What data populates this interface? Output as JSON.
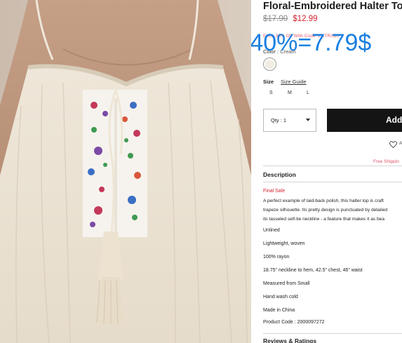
{
  "product": {
    "title": "Floral-Embroidered Halter Top",
    "price_original": "$17.90",
    "price_sale": "$12.99",
    "promo_text": "Extra 30% Off With Code: EXTRA30",
    "overlay_discount": "-40%=7.79$",
    "color_label": "Color :",
    "color_value": "Cream",
    "size_label": "Size",
    "size_guide": "Size Guide",
    "sizes": [
      "S",
      "M",
      "L"
    ],
    "qty_label": "Qty : 1",
    "add_button": "Add",
    "wishlist_text": "A",
    "free_shipping": "Free Shippin",
    "description_title": "Description",
    "final_sale": "Final Sale",
    "description_lines": [
      "A perfect example of laid-back polish, this halter top is craft",
      "trapeze silhouette. Its pretty design is punctuated by detailed",
      "its tasseled self-tie neckline - a feature that makes it as bea"
    ],
    "features": [
      "Unlined",
      "Lightweight, woven",
      "100% rayon",
      "18.75\" neckline to hem, 42.5\" chest, 46\" waist",
      "Measured from Small",
      "Hand wash cold",
      "Made in China",
      "Product Code : 2000097272"
    ],
    "reviews_title": "Reviews & Ratings"
  },
  "colors": {
    "sale_red": "#d3202f",
    "promo_pink": "#e0566a",
    "overlay_blue": "#1a7fe0",
    "button_black": "#141414",
    "fabric_cream": "#f2ece2"
  },
  "icons": {
    "wishlist": "heart-outline-icon",
    "qty_dropdown": "caret-down-icon"
  }
}
